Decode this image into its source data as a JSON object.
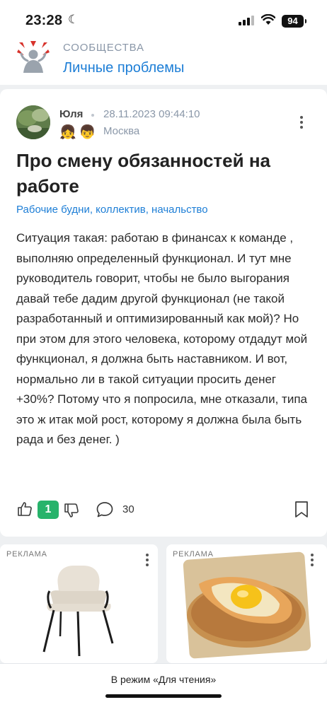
{
  "status_bar": {
    "time": "23:28",
    "battery": "94"
  },
  "header": {
    "section": "СООБЩЕСТВА",
    "community": "Личные проблемы"
  },
  "post": {
    "author": "Юля",
    "date": "28.11.2023 09:44:10",
    "location": "Москва",
    "badges": [
      "👧",
      "👦"
    ],
    "title": "Про смену обязанностей на работе",
    "tags": "Рабочие будни, коллектив, начальство",
    "text": "Ситуация такая: работаю в финансах к команде , выполняю определенный функционал. И тут мне руководитель говорит, чтобы не было выгорания давай тебе дадим другой функционал (не такой разработанный и оптимизированный как мой)? Но при этом для этого человека, которому отдадут мой функционал, я должна быть наставником. И вот, нормально ли в такой ситуации просить денег +30%? Потому что я попросила, мне отказали, типа это ж итак мой рост, которому я должна была быть рада и без денег. )",
    "rating": "1",
    "comments": "30"
  },
  "ads": [
    {
      "label": "РЕКЛАМА",
      "image": "chair-photo"
    },
    {
      "label": "РЕКЛАМА",
      "image": "khachapuri-photo"
    }
  ],
  "footer": {
    "reader_mode": "В режим «Для чтения»"
  },
  "colors": {
    "link": "#1d7ed6",
    "rating": "#27b36b",
    "muted": "#8a97a8"
  }
}
